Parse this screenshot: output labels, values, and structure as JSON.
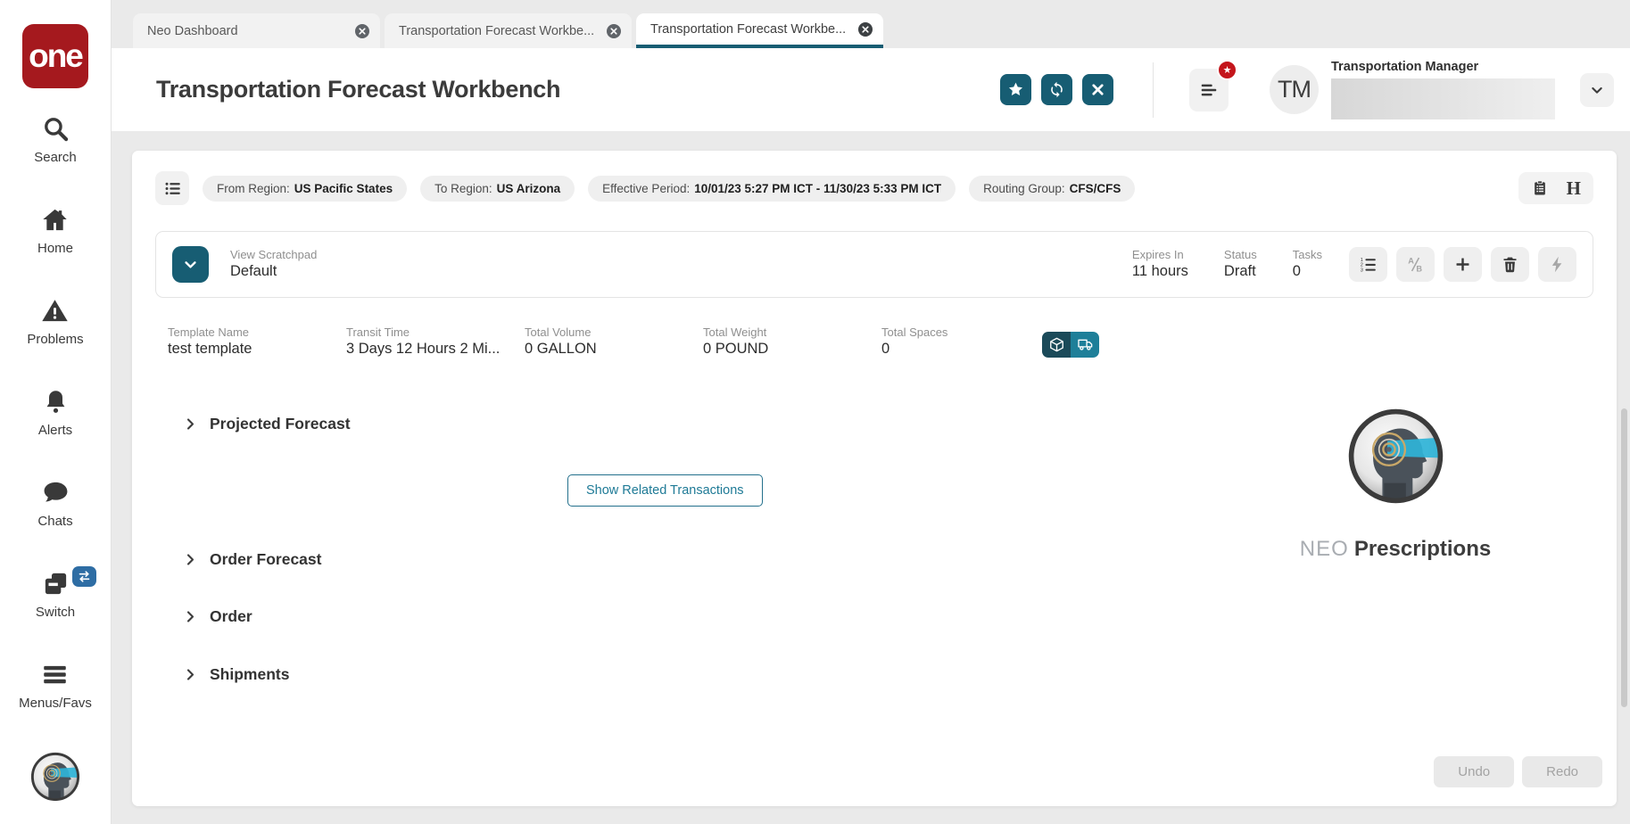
{
  "colors": {
    "accent_teal": "#175d73",
    "logo_red": "#a5191e",
    "badge_red": "#c4161c",
    "switch_blue": "#2e6da4"
  },
  "sidebar": {
    "logo_text": "one",
    "items": [
      {
        "label": "Search",
        "icon": "search-icon"
      },
      {
        "label": "Home",
        "icon": "home-icon"
      },
      {
        "label": "Problems",
        "icon": "warning-icon"
      },
      {
        "label": "Alerts",
        "icon": "bell-icon"
      },
      {
        "label": "Chats",
        "icon": "chat-icon"
      },
      {
        "label": "Switch",
        "icon": "switch-icon"
      },
      {
        "label": "Menus/Favs",
        "icon": "menu-icon"
      }
    ]
  },
  "tabs": [
    {
      "label": "Neo Dashboard"
    },
    {
      "label": "Transportation Forecast Workbe..."
    },
    {
      "label": "Transportation Forecast Workbe..."
    }
  ],
  "header": {
    "title": "Transportation Forecast Workbench",
    "user_initials": "TM",
    "user_role": "Transportation Manager"
  },
  "filters": {
    "pills": [
      {
        "label": "From Region:",
        "value": "US Pacific States"
      },
      {
        "label": "To Region:",
        "value": "US Arizona"
      },
      {
        "label": "Effective Period:",
        "value": "10/01/23 5:27 PM ICT - 11/30/23 5:33 PM ICT"
      },
      {
        "label": "Routing Group:",
        "value": "CFS/CFS"
      }
    ],
    "history_label": "H"
  },
  "scratchpad": {
    "view_label": "View Scratchpad",
    "view_value": "Default",
    "stats": [
      {
        "label": "Expires In",
        "value": "11 hours"
      },
      {
        "label": "Status",
        "value": "Draft"
      },
      {
        "label": "Tasks",
        "value": "0"
      }
    ]
  },
  "summary": [
    {
      "label": "Template Name",
      "value": "test template"
    },
    {
      "label": "Transit Time",
      "value": "3 Days 12 Hours 2 Mi..."
    },
    {
      "label": "Total Volume",
      "value": "0 GALLON"
    },
    {
      "label": "Total Weight",
      "value": "0 POUND"
    },
    {
      "label": "Total Spaces",
      "value": "0"
    }
  ],
  "sections": [
    {
      "label": "Projected Forecast"
    },
    {
      "label": "Order Forecast"
    },
    {
      "label": "Order"
    },
    {
      "label": "Shipments"
    }
  ],
  "actions": {
    "show_related": "Show Related Transactions",
    "undo": "Undo",
    "redo": "Redo"
  },
  "neo": {
    "brand": "NEO",
    "title": "Prescriptions"
  }
}
